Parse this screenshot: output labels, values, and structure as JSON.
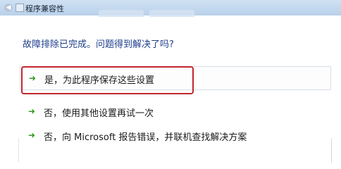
{
  "window": {
    "title": "程序兼容性"
  },
  "icons": {
    "back": "back-arrow-icon",
    "app": "compat-app-icon",
    "option": "green-arrow-icon"
  },
  "main": {
    "question": "故障排除已完成。问题得到解决了吗?",
    "options": [
      {
        "label": "是，为此程序保存这些设置",
        "highlighted": true
      },
      {
        "label": "否，使用其他设置再试一次"
      },
      {
        "label": "否，向 Microsoft 报告错误，并联机查找解决方案"
      }
    ]
  },
  "colors": {
    "question_text": "#1e3f8c",
    "arrow": "#2f9a1d",
    "highlight_border": "#c0272d",
    "titlebar": "#b9d1ea"
  }
}
